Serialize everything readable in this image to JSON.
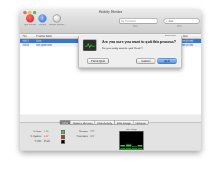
{
  "window": {
    "title": "Activity Monitor"
  },
  "toolbar": {
    "quit_label": "Quit Process",
    "inspect_label": "Inspect",
    "sample_label": "Sample Process",
    "filter_value": "My Processes",
    "filter_caption": "Show",
    "search_value": "dock",
    "search_caption": "Filter"
  },
  "table": {
    "columns": [
      "PID",
      "Process Name",
      "Real Mem",
      "Kind"
    ],
    "rows": [
      {
        "pid": "94517",
        "name": "Dock",
        "mem": "14.7 MB",
        "kind": "Intel (64 bit)",
        "selected": true
      },
      {
        "pid": "94518",
        "name": "com.apple.dock",
        "mem": "22.8 MB",
        "kind": "Intel (64 bit)",
        "selected": false
      }
    ]
  },
  "dialog": {
    "message": "Are you sure you want to quit this process?",
    "detail": "Do you really want to quit “Dock”?",
    "force_quit_label": "Force Quit",
    "cancel_label": "Cancel",
    "quit_label": "Quit"
  },
  "tabs": [
    "CPU",
    "System Memory",
    "Disk Activity",
    "Disk Usage",
    "Network"
  ],
  "cpu_panel": {
    "user_label": "% User:",
    "user_value": "4.50",
    "system_label": "% System:",
    "system_value": "4.27",
    "idle_label": "% Idle:",
    "idle_value": "89.26",
    "threads_label": "Threads:",
    "threads_value": "777",
    "processes_label": "Processes:",
    "processes_value": "177",
    "usage_caption": "CPU Usage"
  },
  "colors": {
    "user": "#39d039",
    "system": "#e02020",
    "idle": "#000000",
    "selection": "#3875d7"
  }
}
